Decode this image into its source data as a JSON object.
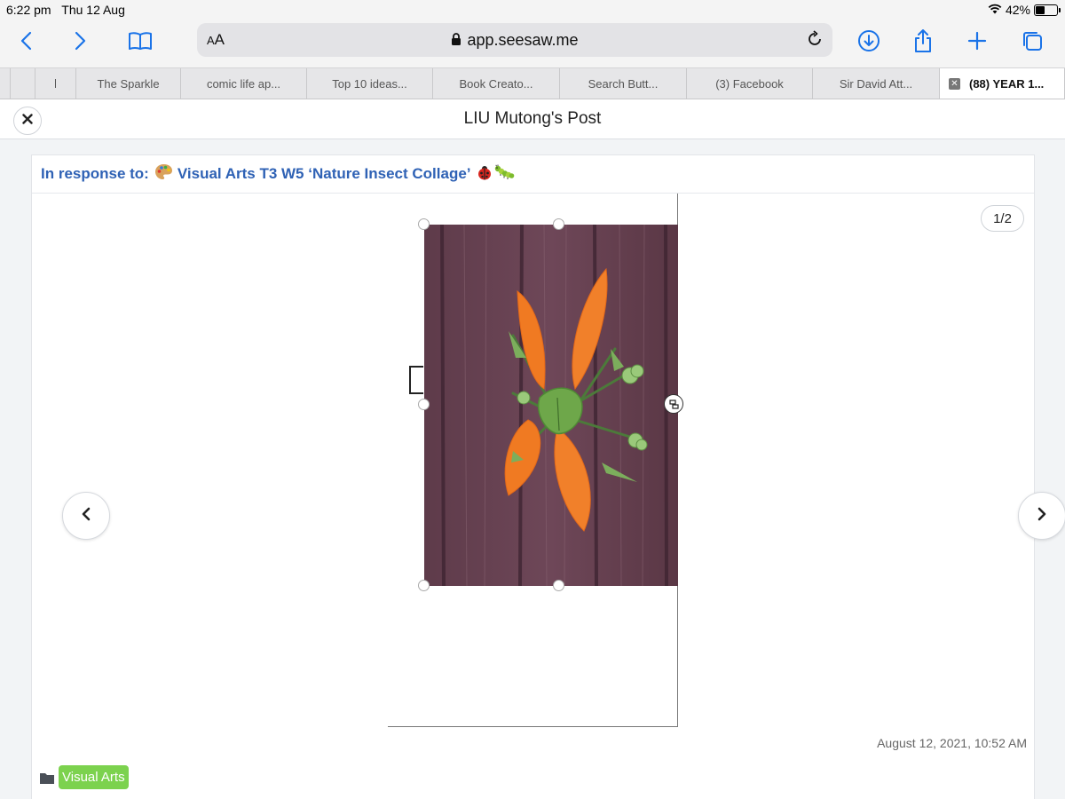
{
  "status_bar": {
    "time": "6:22 pm",
    "date": "Thu 12 Aug",
    "battery_percent": "42%",
    "battery_level": 0.42
  },
  "toolbar": {
    "icons": [
      "back-icon",
      "forward-icon",
      "bookmarks-icon",
      "reload-icon",
      "download-icon",
      "share-icon",
      "new-tab-icon",
      "tabs-overview-icon"
    ],
    "reader_label": "AA",
    "url": "app.seesaw.me",
    "accent_color": "#1a73e8"
  },
  "tabs": [
    {
      "label": ""
    },
    {
      "label": ""
    },
    {
      "label": "The Sparkle"
    },
    {
      "label": "comic life ap..."
    },
    {
      "label": "Top 10 ideas..."
    },
    {
      "label": "Book Creato..."
    },
    {
      "label": "Search Butt..."
    },
    {
      "label": "(3) Facebook"
    },
    {
      "label": "Sir David Att..."
    },
    {
      "label": "(88) YEAR 1...",
      "active": true
    }
  ],
  "post": {
    "title": "LIU Mutong's Post",
    "response_label": "In response to:",
    "activity_title": "Visual Arts T3 W5 ‘Nature Insect Collage’",
    "activity_emojis": [
      "palette-icon",
      "ladybug-icon",
      "caterpillar-icon"
    ],
    "page_counter": "1/2",
    "timestamp": "August 12, 2021, 10:52 AM",
    "folder_tag": "Visual Arts",
    "tag_color": "#7cd24e",
    "link_color": "#2f62b5"
  }
}
